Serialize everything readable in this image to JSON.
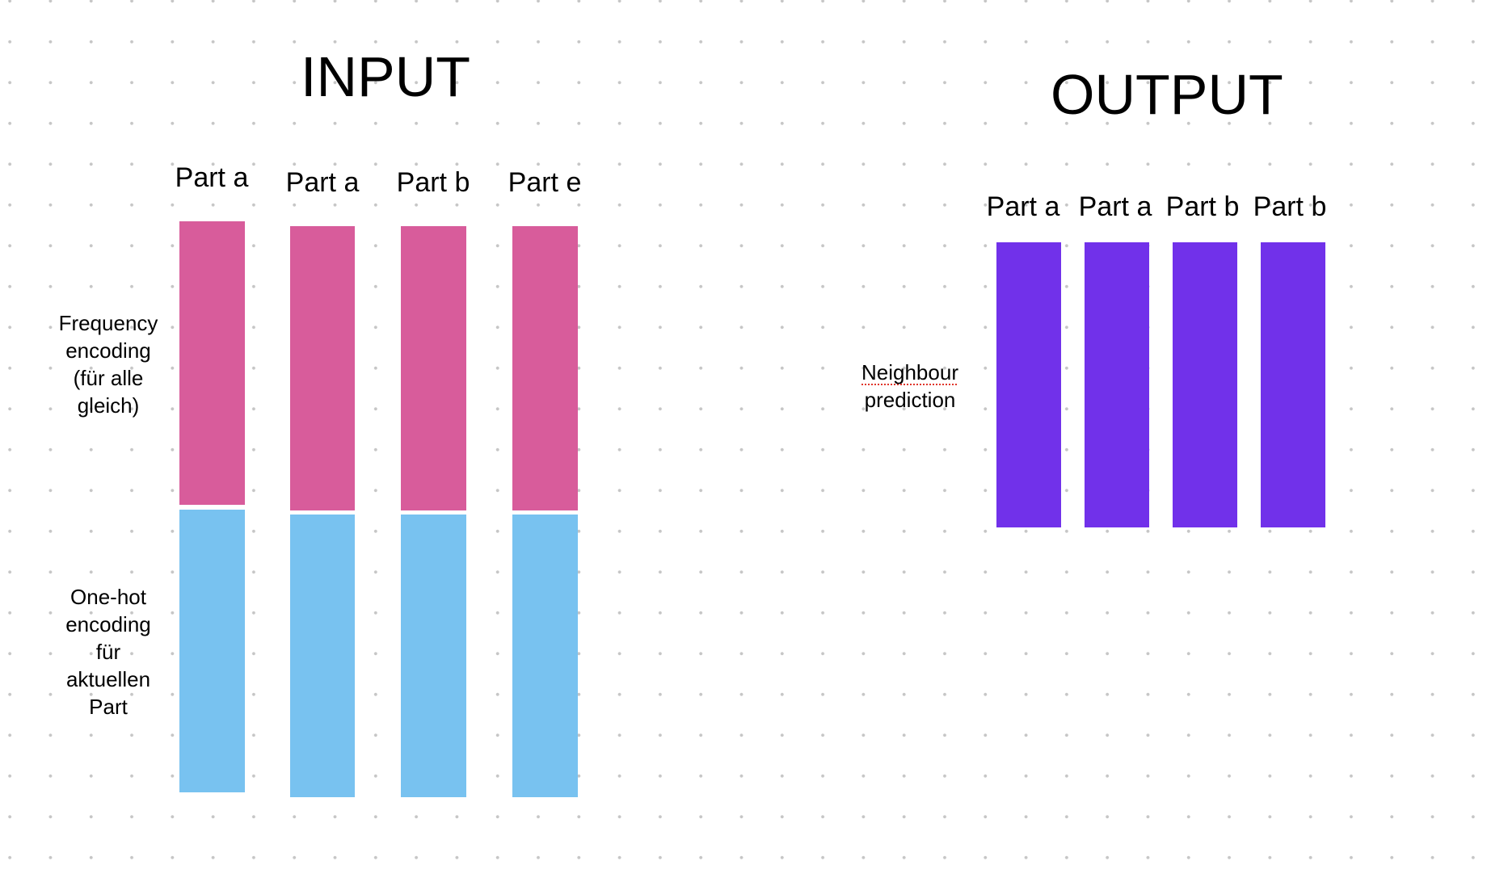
{
  "colors": {
    "frequency_block": "#d85c9b",
    "onehot_block": "#78c2f0",
    "output_block": "#7131ea",
    "dot_grid": "#c6c6c6",
    "spellcheck_underline": "#e0352b"
  },
  "input": {
    "title": "INPUT",
    "columns": [
      {
        "label": "Part a"
      },
      {
        "label": "Part a"
      },
      {
        "label": "Part b"
      },
      {
        "label": "Part e"
      }
    ],
    "row_labels": {
      "frequency": [
        "Frequency",
        "encoding",
        "(für alle",
        "gleich)"
      ],
      "onehot": [
        "One-hot",
        "encoding",
        "für",
        "aktuellen",
        "Part"
      ]
    }
  },
  "output": {
    "title": "OUTPUT",
    "columns": [
      {
        "label": "Part a"
      },
      {
        "label": "Part a"
      },
      {
        "label": "Part b"
      },
      {
        "label": "Part b"
      }
    ],
    "row_label": [
      "Neighbour",
      "prediction"
    ]
  }
}
